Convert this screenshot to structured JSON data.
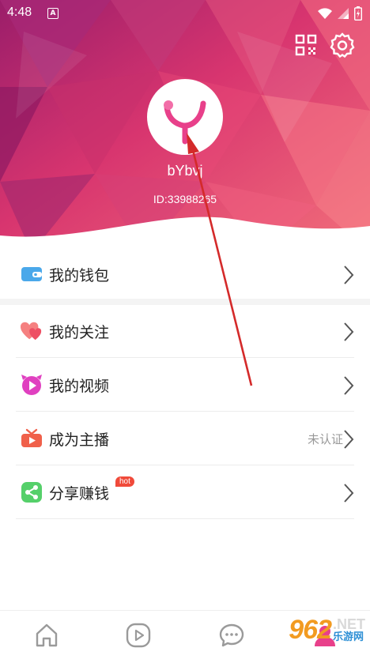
{
  "colors": {
    "accent": "#e8408a",
    "header_dark": "#b4236e",
    "header_light": "#f0607a"
  },
  "status_bar": {
    "time": "4:48",
    "notif_letter": "A"
  },
  "profile": {
    "username": "bYbvj",
    "user_id": "ID:33988265"
  },
  "menu": [
    {
      "label": "我的钱包",
      "icon": "wallet-icon",
      "color": "#4aa8ea"
    },
    {
      "label": "我的关注",
      "icon": "hearts-icon",
      "color": "#f06a6a"
    },
    {
      "label": "我的视频",
      "icon": "video-icon",
      "color": "#e040c0"
    },
    {
      "label": "成为主播",
      "icon": "tv-icon",
      "color": "#f0604a",
      "hint": "未认证"
    },
    {
      "label": "分享赚钱",
      "icon": "share-icon",
      "color": "#55d06a",
      "badge": "hot"
    }
  ],
  "tabs": [
    "home-icon",
    "play-icon",
    "chat-icon",
    "profile-icon"
  ],
  "watermark": {
    "number": "962",
    "net": ".NET",
    "site": "乐游网"
  }
}
